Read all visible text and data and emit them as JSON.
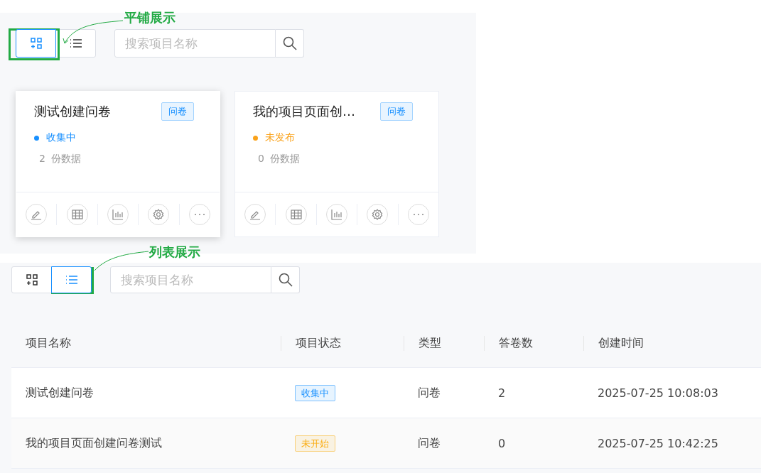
{
  "tile_view": {
    "annotation": "平铺展示",
    "toggle": [
      {
        "kind": "grid",
        "selected": true
      },
      {
        "kind": "list",
        "selected": false
      }
    ],
    "search": {
      "placeholder": "搜索项目名称"
    },
    "cards": [
      {
        "title": "测试创建问卷",
        "tag": "问卷",
        "status": "收集中",
        "color": "#1890ff",
        "count": "2",
        "count_label": "份数据",
        "raised": true
      },
      {
        "title": "我的项目页面创…",
        "tag": "问卷",
        "status": "未发布",
        "color": "#faa21a",
        "count": "0",
        "count_label": "份数据",
        "raised": false
      }
    ]
  },
  "list_view": {
    "annotation": "列表展示",
    "toggle": [
      {
        "kind": "grid",
        "selected": false
      },
      {
        "kind": "list",
        "selected": true
      }
    ],
    "search": {
      "placeholder": "搜索项目名称"
    },
    "table": {
      "columns": [
        "项目名称",
        "项目状态",
        "类型",
        "答卷数",
        "创建时间"
      ],
      "rows": [
        {
          "name": "测试创建问卷",
          "status": "收集中",
          "color": "#1890ff",
          "type": "问卷",
          "count": "2",
          "created": "2025-07-25 10:08:03"
        },
        {
          "name": "我的项目页面创建问卷测试",
          "status": "未开始",
          "color": "#faad14",
          "type": "问卷",
          "count": "0",
          "created": "2025-07-25 10:42:25"
        }
      ]
    }
  }
}
